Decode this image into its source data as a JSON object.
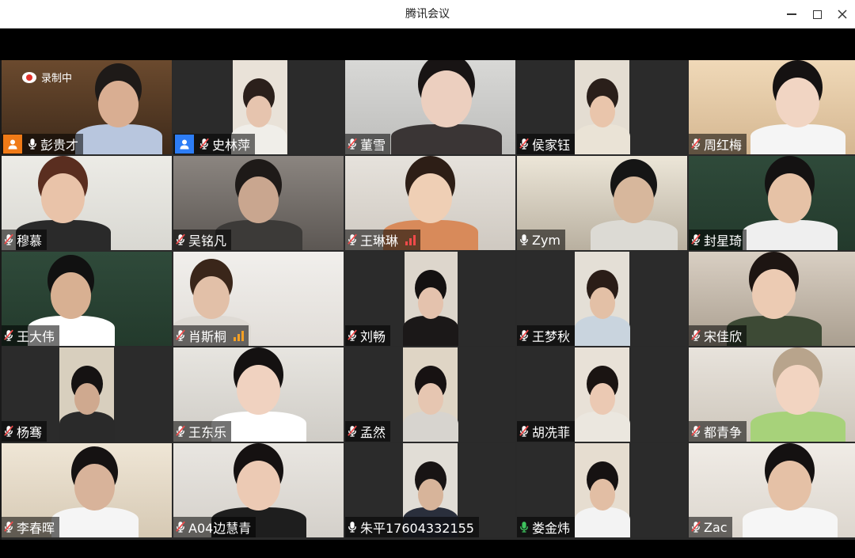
{
  "window": {
    "title": "腾讯会议"
  },
  "recording": {
    "label": "录制中"
  },
  "participants": [
    {
      "name": "彭贵才",
      "mic": "on",
      "avatar": "orange"
    },
    {
      "name": "史林萍",
      "mic": "muted",
      "avatar": "blue"
    },
    {
      "name": "董雪",
      "mic": "muted"
    },
    {
      "name": "侯家钰",
      "mic": "muted"
    },
    {
      "name": "周红梅",
      "mic": "muted"
    },
    {
      "name": "穆慕",
      "mic": "muted"
    },
    {
      "name": "吴铭凡",
      "mic": "muted"
    },
    {
      "name": "王琳琳",
      "mic": "muted",
      "signal": "red"
    },
    {
      "name": "Zym",
      "mic": "on"
    },
    {
      "name": "封星琦",
      "mic": "muted"
    },
    {
      "name": "王大伟",
      "mic": "muted"
    },
    {
      "name": "肖斯桐",
      "mic": "muted",
      "signal": "orange"
    },
    {
      "name": "刘畅",
      "mic": "muted"
    },
    {
      "name": "王梦秋",
      "mic": "muted"
    },
    {
      "name": "宋佳欣",
      "mic": "muted"
    },
    {
      "name": "杨骞",
      "mic": "muted"
    },
    {
      "name": "王东乐",
      "mic": "muted"
    },
    {
      "name": "孟然",
      "mic": "muted"
    },
    {
      "name": "胡冼菲",
      "mic": "muted"
    },
    {
      "name": "都青争",
      "mic": "muted"
    },
    {
      "name": "李春晖",
      "mic": "muted"
    },
    {
      "name": "A04边慧青",
      "mic": "muted"
    },
    {
      "name": "朱平17604332155",
      "mic": "on"
    },
    {
      "name": "娄金炜",
      "mic": "speaking",
      "active": true
    },
    {
      "name": "Zac",
      "mic": "muted"
    }
  ],
  "colors": {
    "mic_speaking": "#3ec45e",
    "active_border": "#3da35d",
    "badge_orange": "#f07a17",
    "badge_blue": "#2d7df6"
  }
}
